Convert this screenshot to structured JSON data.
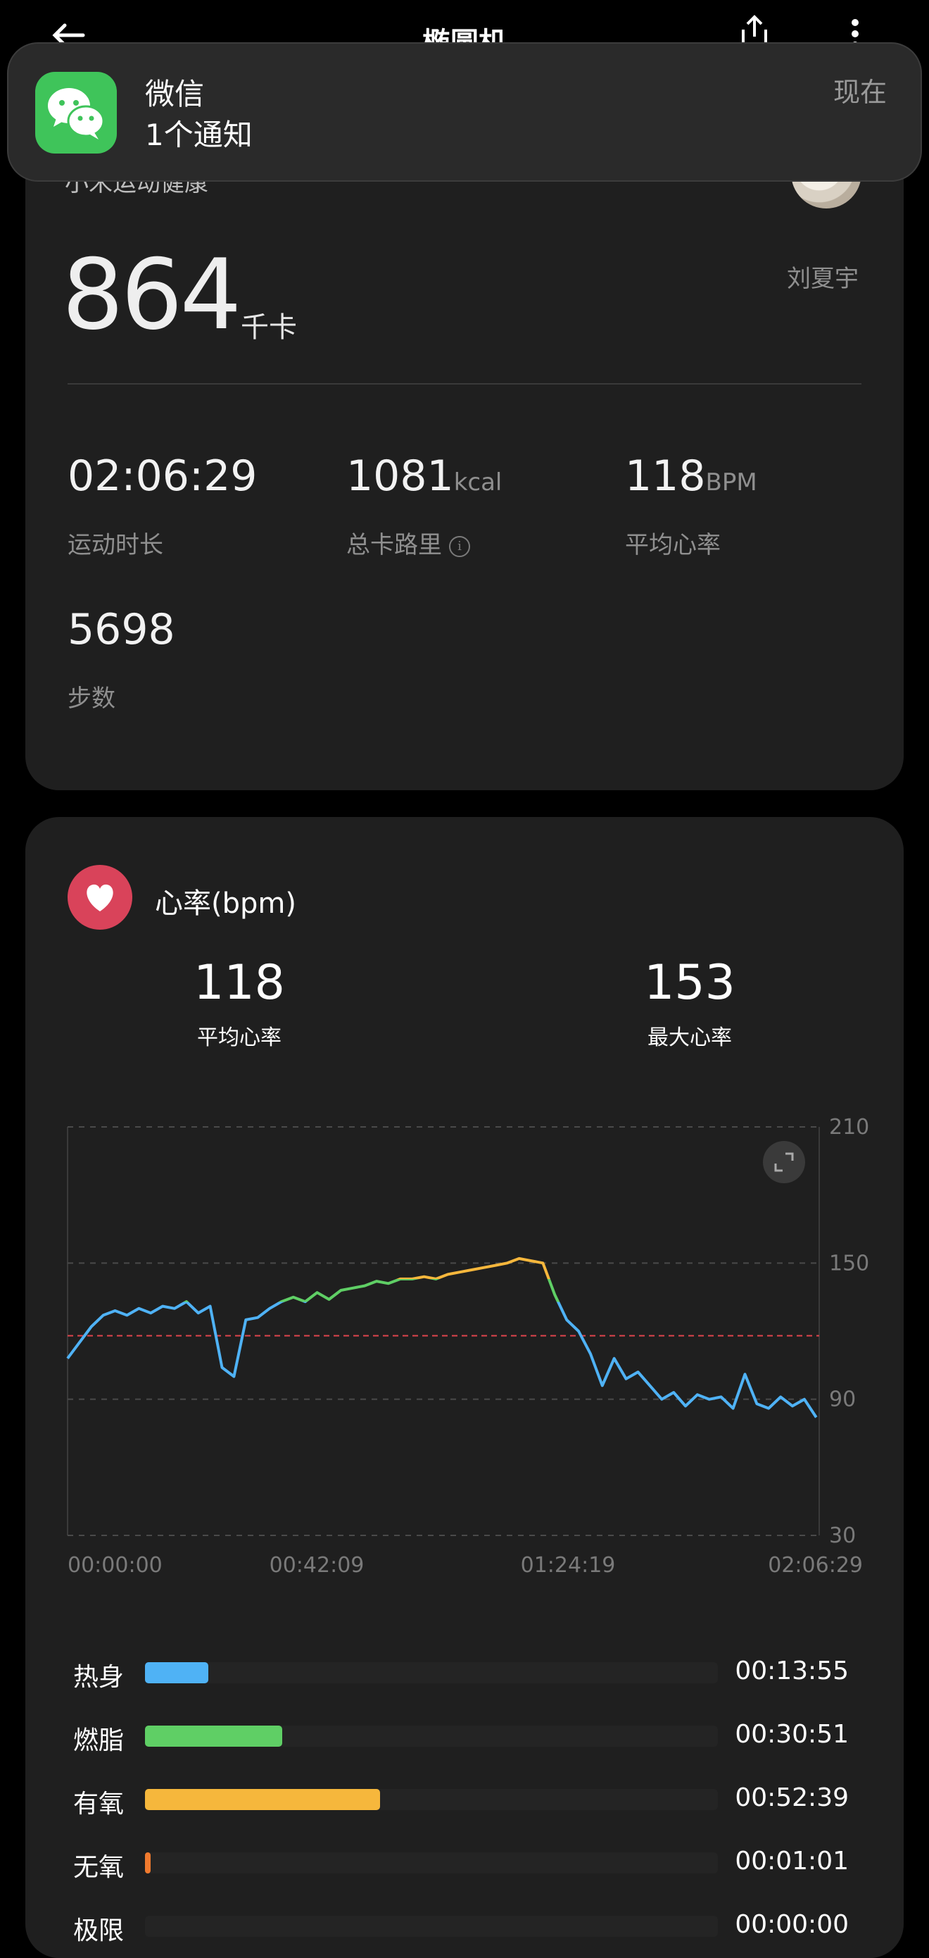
{
  "app": {
    "title": "椭圆机"
  },
  "notification": {
    "app_name": "微信",
    "message": "1个通知",
    "time": "现在",
    "icon": "wechat-icon"
  },
  "summary": {
    "source": "小米运动健康",
    "user_name": "刘夏宇",
    "calories": "864",
    "calories_unit": "千卡",
    "stats": [
      {
        "value": "02:06:29",
        "unit": "",
        "label": "运动时长"
      },
      {
        "value": "1081",
        "unit": "kcal",
        "label": "总卡路里"
      },
      {
        "value": "118",
        "unit": "BPM",
        "label": "平均心率"
      },
      {
        "value": "5698",
        "unit": "",
        "label": "步数"
      }
    ]
  },
  "heart_rate": {
    "title": "心率(bpm)",
    "avg_value": "118",
    "avg_label": "平均心率",
    "max_value": "153",
    "max_label": "最大心率",
    "zones": [
      {
        "name": "热身",
        "time": "00:13:55",
        "color": "#4fb2f5",
        "fraction": 0.11
      },
      {
        "name": "燃脂",
        "time": "00:30:51",
        "color": "#5fcf65",
        "fraction": 0.24
      },
      {
        "name": "有氧",
        "time": "00:52:39",
        "color": "#f6b73c",
        "fraction": 0.41
      },
      {
        "name": "无氧",
        "time": "00:01:01",
        "color": "#f07a2e",
        "fraction": 0.01
      },
      {
        "name": "极限",
        "time": "00:00:00",
        "color": "#e2445c",
        "fraction": 0
      }
    ]
  },
  "chart_data": {
    "type": "line",
    "ylim": [
      30,
      210
    ],
    "y_ticks": [
      "210",
      "150",
      "90",
      "30"
    ],
    "x_ticks": [
      "00:00:00",
      "00:42:09",
      "01:24:19",
      "02:06:29"
    ],
    "avg_line": 118,
    "grid": true,
    "x_minutes": [
      0,
      2,
      4,
      6,
      8,
      10,
      12,
      14,
      16,
      18,
      20,
      22,
      24,
      26,
      28,
      30,
      32,
      34,
      36,
      38,
      40,
      42,
      44,
      46,
      48,
      50,
      52,
      54,
      56,
      58,
      60,
      62,
      64,
      66,
      68,
      70,
      72,
      74,
      76,
      78,
      80,
      82,
      84,
      86,
      88,
      90,
      92,
      94,
      96,
      98,
      100,
      102,
      104,
      106,
      108,
      110,
      112,
      114,
      116,
      118,
      120,
      122,
      124,
      126
    ],
    "values": [
      108,
      115,
      122,
      127,
      129,
      127,
      130,
      128,
      131,
      130,
      133,
      128,
      131,
      104,
      100,
      125,
      126,
      130,
      133,
      135,
      133,
      137,
      134,
      138,
      139,
      140,
      142,
      141,
      143,
      143,
      144,
      143,
      145,
      146,
      147,
      148,
      149,
      150,
      152,
      151,
      150,
      136,
      125,
      120,
      110,
      96,
      108,
      99,
      102,
      96,
      90,
      93,
      87,
      92,
      90,
      91,
      86,
      101,
      88,
      86,
      91,
      87,
      90,
      82
    ],
    "zone_colors": [
      "#4fb2f5",
      "#5fcf65",
      "#f6b73c"
    ],
    "expand_icon": "expand-icon"
  }
}
